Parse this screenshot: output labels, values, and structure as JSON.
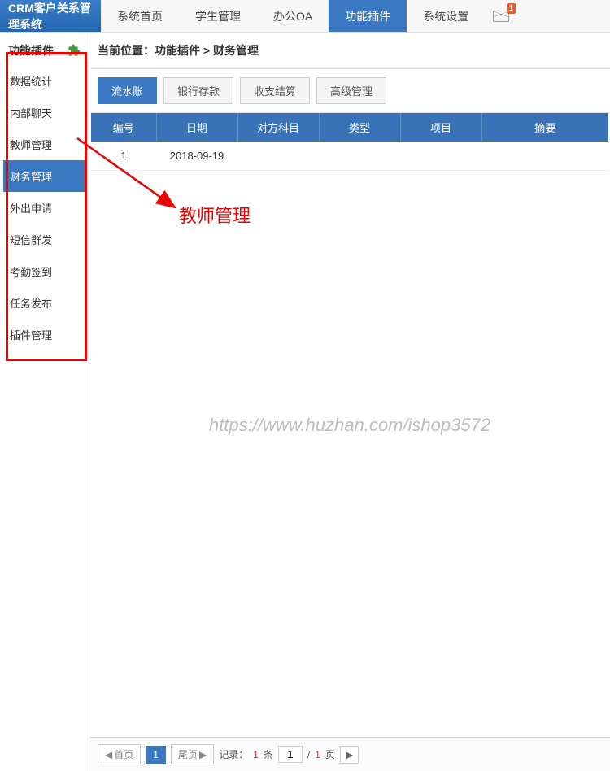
{
  "brand": "CRM客户关系管理系统",
  "nav": [
    {
      "label": "系统首页",
      "active": false
    },
    {
      "label": "学生管理",
      "active": false
    },
    {
      "label": "办公OA",
      "active": false
    },
    {
      "label": "功能插件",
      "active": true
    },
    {
      "label": "系统设置",
      "active": false
    }
  ],
  "mail_badge": "1",
  "sidebar": {
    "title": "功能插件",
    "items": [
      {
        "label": "数据统计",
        "active": false
      },
      {
        "label": "内部聊天",
        "active": false
      },
      {
        "label": "教师管理",
        "active": false
      },
      {
        "label": "财务管理",
        "active": true
      },
      {
        "label": "外出申请",
        "active": false
      },
      {
        "label": "短信群发",
        "active": false
      },
      {
        "label": "考勤签到",
        "active": false
      },
      {
        "label": "任务发布",
        "active": false
      },
      {
        "label": "插件管理",
        "active": false
      }
    ]
  },
  "breadcrumb": {
    "prefix": "当前位置：",
    "path": "功能插件 > 财务管理"
  },
  "tabs": [
    {
      "label": "流水账",
      "active": true
    },
    {
      "label": "银行存款",
      "active": false
    },
    {
      "label": "收支结算",
      "active": false
    },
    {
      "label": "高级管理",
      "active": false
    }
  ],
  "table": {
    "headers": [
      "编号",
      "日期",
      "对方科目",
      "类型",
      "项目",
      "摘要"
    ],
    "rows": [
      {
        "id": "1",
        "date": "2018-09-19",
        "subject": "",
        "type": "",
        "project": "",
        "summary": ""
      }
    ]
  },
  "watermark": "https://www.huzhan.com/ishop3572",
  "pager": {
    "first": "首页",
    "page_num": "1",
    "last": "尾页",
    "records_label": "记录：",
    "records_count": "1",
    "records_unit": " 条",
    "current_page": "1",
    "total_pages": "1",
    "page_sep": " / ",
    "page_unit": " 页"
  },
  "annotation": {
    "label": "教师管理"
  }
}
